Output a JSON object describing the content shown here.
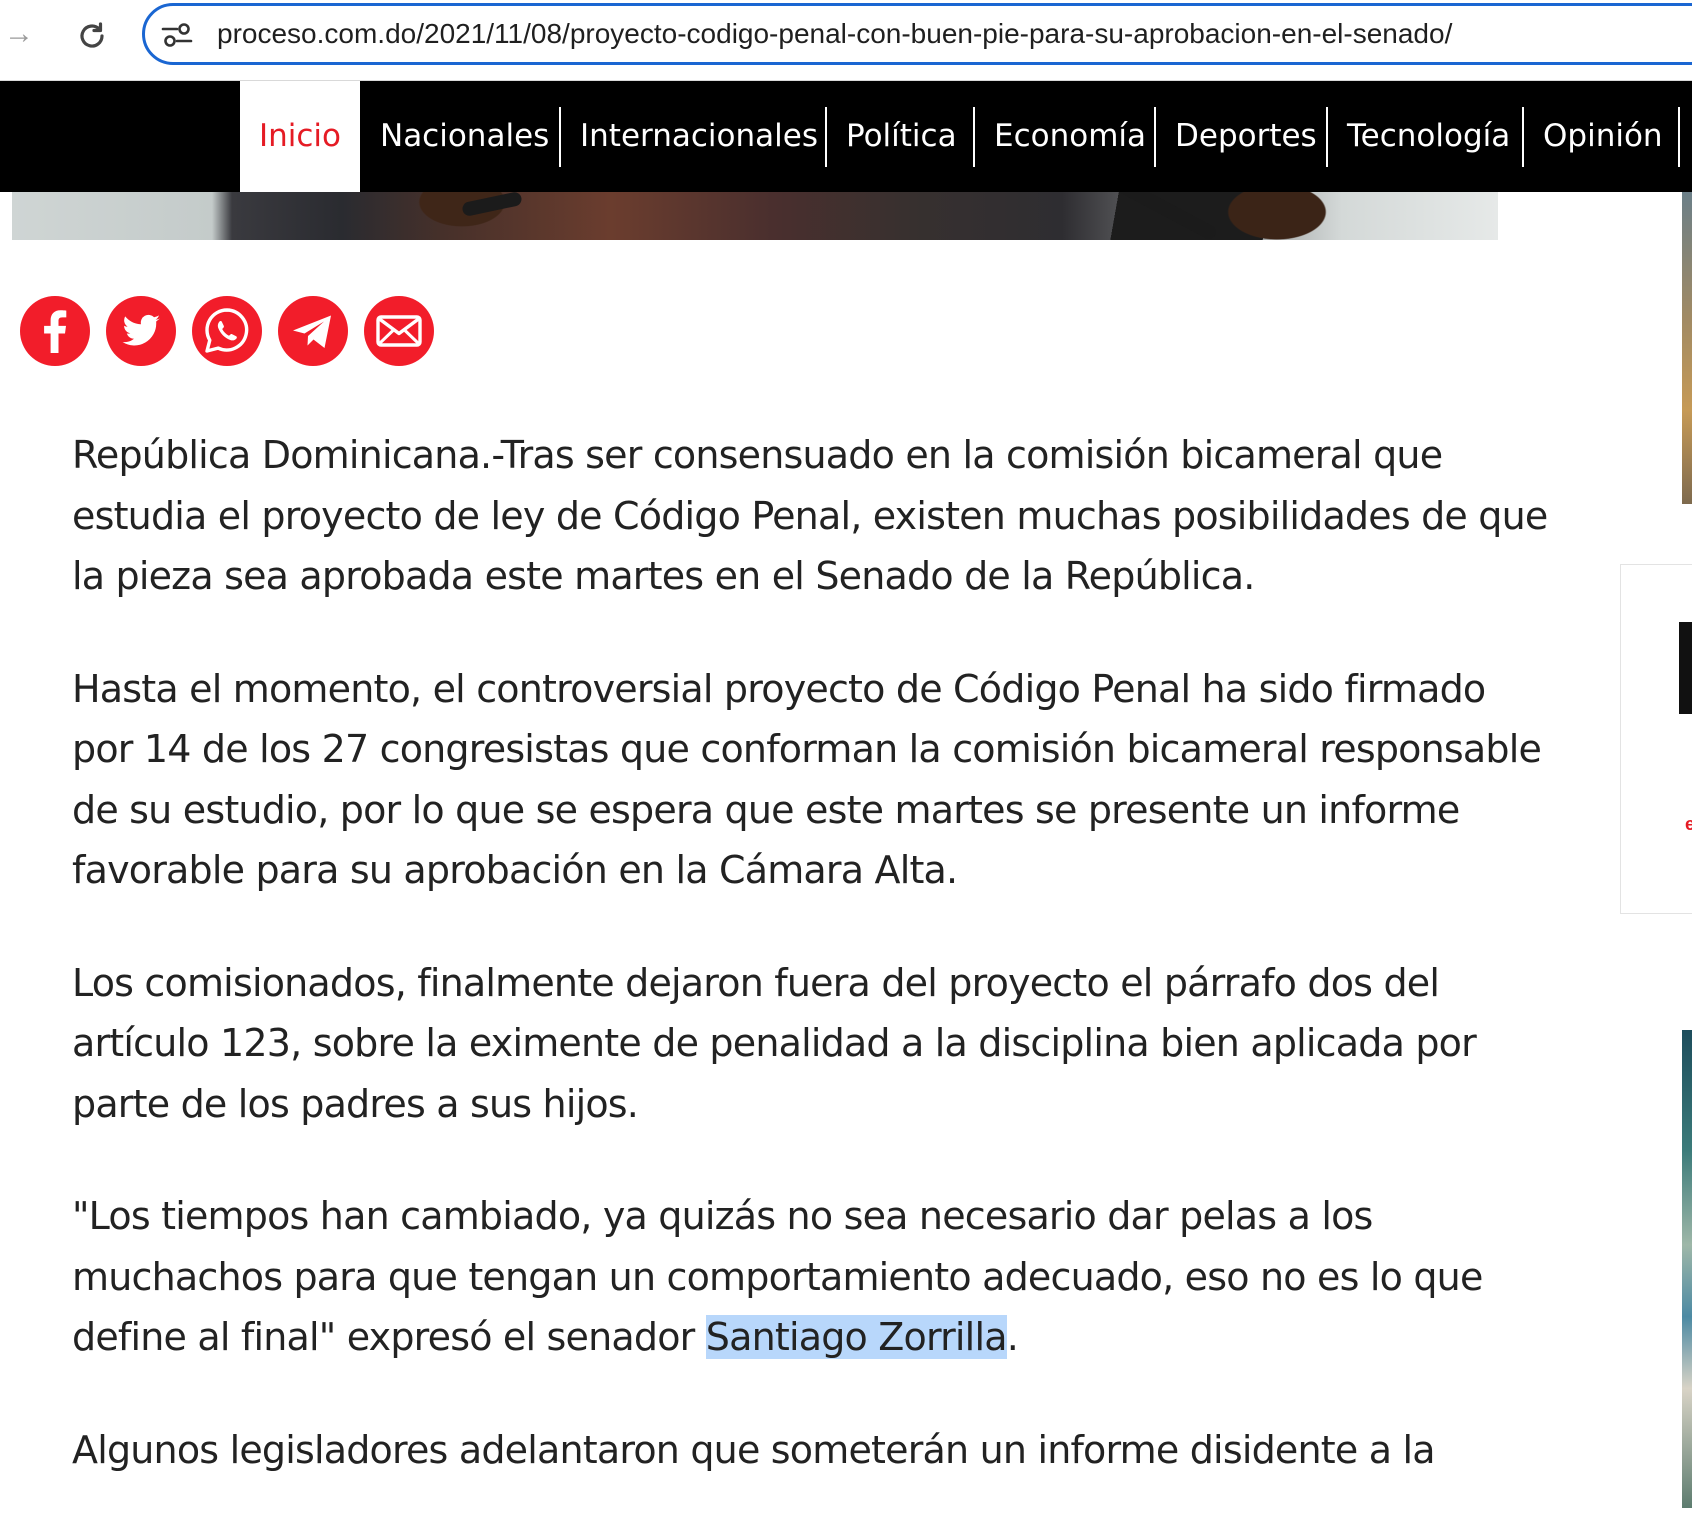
{
  "browser": {
    "url": "proceso.com.do/2021/11/08/proyecto-codigo-penal-con-buen-pie-para-su-aprobacion-en-el-senado/",
    "icons": [
      "forward-icon",
      "reload-icon",
      "site-info-icon"
    ]
  },
  "nav": {
    "items": [
      {
        "label": "Inicio",
        "active": true
      },
      {
        "label": "Nacionales"
      },
      {
        "label": "Internacionales"
      },
      {
        "label": "Política"
      },
      {
        "label": "Economía"
      },
      {
        "label": "Deportes"
      },
      {
        "label": "Tecnología"
      },
      {
        "label": "Opinión"
      }
    ],
    "active_color": "#e51b24"
  },
  "share": {
    "color": "#f21d2a",
    "icons": [
      "facebook-icon",
      "twitter-icon",
      "whatsapp-icon",
      "telegram-icon",
      "email-icon"
    ]
  },
  "article": {
    "p1": [
      "República Dominicana.-Tras ser consensuado en la comisión bicameral que",
      "estudia el proyecto de ley de Código Penal, existen muchas posibilidades de que",
      "la pieza sea aprobada este martes en el Senado de la República."
    ],
    "p2": [
      "Hasta el momento, el controversial proyecto de Código Penal ha sido firmado",
      "por 14 de los 27 congresistas que conforman la comisión bicameral responsable",
      "de su estudio, por lo que se espera que este martes se presente un informe",
      "favorable para su aprobación en la Cámara Alta."
    ],
    "p3": [
      "Los comisionados, finalmente dejaron fuera del proyecto el párrafo dos del",
      "artículo 123, sobre la eximente de penalidad a la disciplina bien aplicada por",
      "parte de los padres a sus hijos."
    ],
    "p4": [
      "\"Los tiempos han cambiado, ya quizás no sea necesario dar pelas a los",
      "muchachos para que tengan un comportamiento adecuado, eso no es lo que"
    ],
    "p4_last_before": "define al final\" expresó el senador ",
    "p4_highlight": "Santiago Zorrilla",
    "p4_last_after": ".",
    "p5": [
      "Algunos legisladores adelantaron que someterán un informe disidente a la"
    ]
  },
  "sidebar": {
    "card_text": "e"
  },
  "colors": {
    "selection": "#b8d7fb",
    "text": "#222222",
    "nav_bg": "#000000"
  }
}
